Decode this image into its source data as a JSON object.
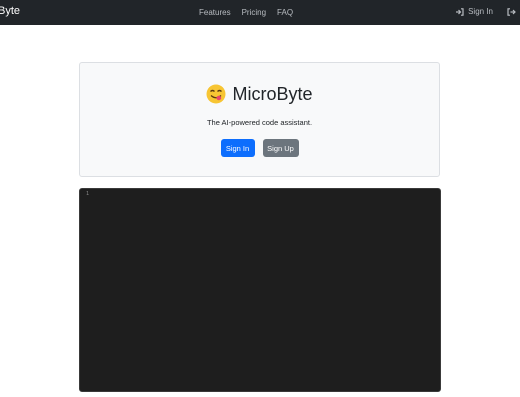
{
  "navbar": {
    "brand": "Byte",
    "links": [
      "Features",
      "Pricing",
      "FAQ"
    ],
    "signin_label": "Sign In",
    "icons": [
      "sign-in-icon",
      "sign-out-icon"
    ]
  },
  "hero": {
    "emoji": "😋",
    "title": "MicroByte",
    "subtitle": "The AI-powered code assistant.",
    "signin_button": "Sign In",
    "signup_button": "Sign Up"
  },
  "editor": {
    "line_numbers": [
      "1"
    ],
    "content": ""
  },
  "colors": {
    "navbar_bg": "#212529",
    "primary": "#0d6efd",
    "secondary": "#6c757d",
    "editor_bg": "#1e1e1e"
  }
}
